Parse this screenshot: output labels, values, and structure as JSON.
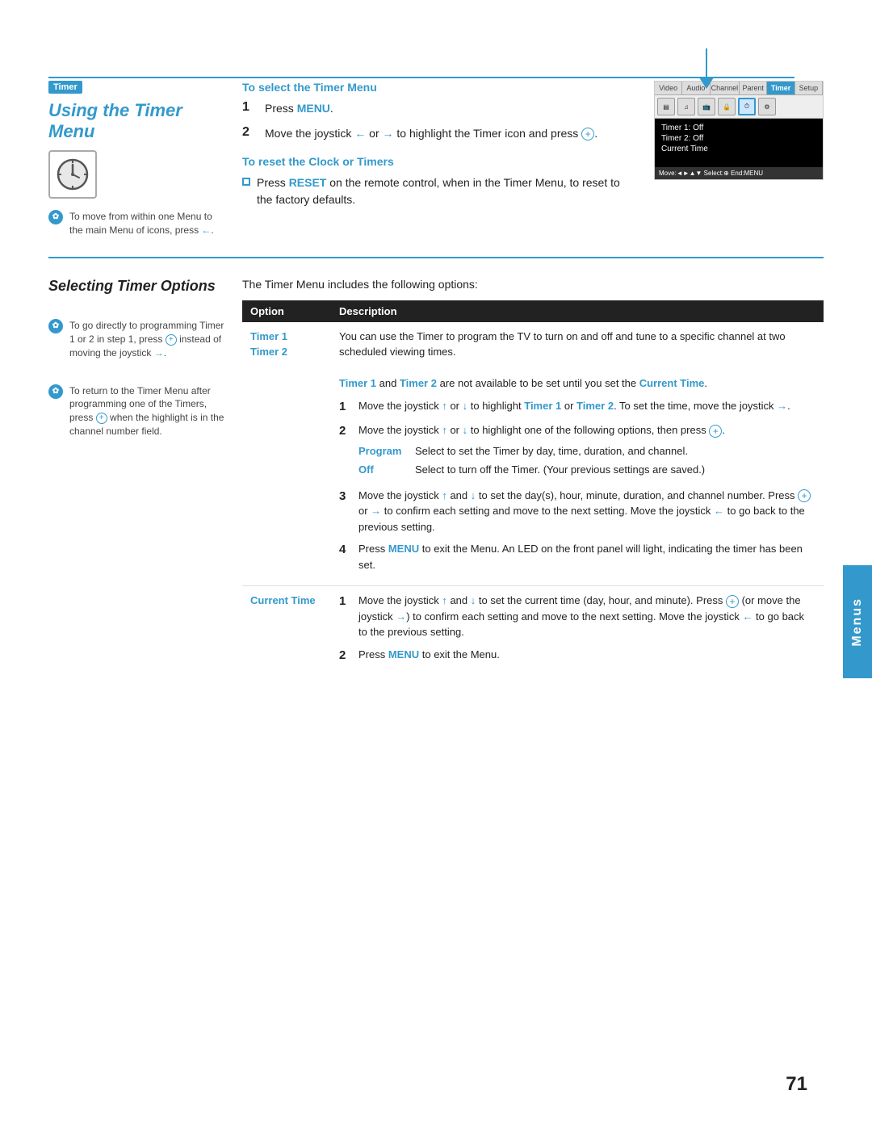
{
  "page": {
    "number": "71",
    "right_tab_label": "Menus"
  },
  "section1": {
    "badge_label": "Timer",
    "title": "Using the Timer Menu",
    "tip1": "To move from within one Menu to the main Menu of icons, press ←.",
    "select_timer_title": "To select the Timer Menu",
    "step1_label": "1",
    "step1_text": "Press MENU.",
    "step2_label": "2",
    "step2_text": "Move the joystick ← or → to highlight the Timer icon and press ⊕.",
    "reset_title": "To reset the Clock or Timers",
    "reset_bullet": "Press RESET on the remote control, when in the Timer Menu, to reset to the factory defaults.",
    "tv_tabs": [
      "Video",
      "Audio",
      "Channel",
      "Parent",
      "Timer",
      "Setup"
    ],
    "tv_content_lines": [
      "Timer 1: Off",
      "Timer 2: Off",
      "Current Time"
    ],
    "tv_footer": "Move:◄►▲▼  Select:⊕  End:MENU"
  },
  "section2": {
    "title": "Selecting Timer Options",
    "intro": "The Timer Menu includes the following options:",
    "table_headers": [
      "Option",
      "Description"
    ],
    "tip2": "To go directly to programming Timer 1 or 2 in step 1, press ⊕ instead of moving the joystick →.",
    "tip3": "To return to the Timer Menu after programming one of the Timers, press ⊕ when the highlight is in the channel number field.",
    "rows": [
      {
        "option": "Timer 1\nTimer 2",
        "description_intro": "You can use the Timer to program the TV to turn on and off and tune to a specific channel at two scheduled viewing times.",
        "note": "Timer 1 and Timer 2 are not available to be set until you set the Current Time.",
        "steps": [
          {
            "num": "1",
            "text": "Move the joystick ↑ or ↓ to highlight Timer 1 or Timer 2. To set the time, move the joystick →."
          },
          {
            "num": "2",
            "text": "Move the joystick ↑ or ↓ to highlight one of the following options, then press ⊕."
          }
        ],
        "sub_options": [
          {
            "label": "Program",
            "text": "Select to set the Timer by day, time, duration, and channel."
          },
          {
            "label": "Off",
            "text": "Select to turn off the Timer. (Your previous settings are saved.)"
          }
        ],
        "steps2": [
          {
            "num": "3",
            "text": "Move the joystick ↑ and ↓ to set the day(s), hour, minute, duration, and channel number. Press ⊕ or → to confirm each setting and move to the next setting. Move the joystick ← to go back to the previous setting."
          },
          {
            "num": "4",
            "text": "Press MENU to exit the Menu. An LED on the front panel will light, indicating the timer has been set."
          }
        ]
      },
      {
        "option": "Current Time",
        "steps": [
          {
            "num": "1",
            "text": "Move the joystick ↑ and ↓ to set the current time (day, hour, and minute). Press ⊕ (or move the joystick →) to confirm each setting and move to the next setting. Move the joystick ← to go back to the previous setting."
          },
          {
            "num": "2",
            "text": "Press MENU to exit the Menu."
          }
        ]
      }
    ]
  }
}
